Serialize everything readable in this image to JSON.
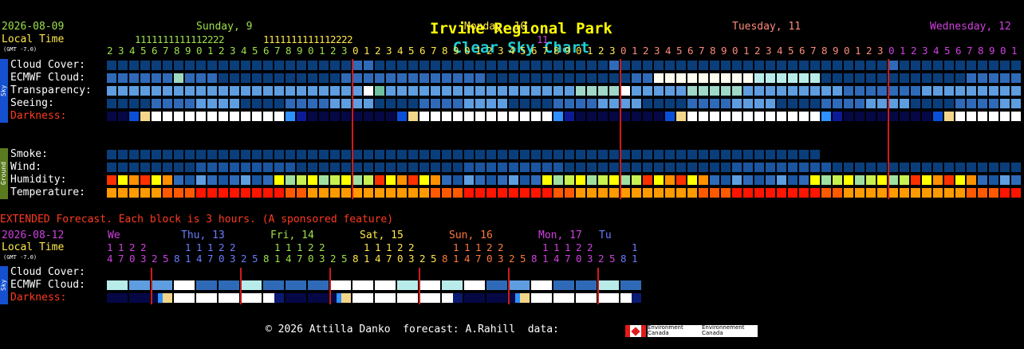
{
  "title": {
    "location": "Irvine Regional Park",
    "suffix": "Clear Sky Chart",
    "location_color": "#ffff00",
    "suffix_color": "#1fcfd3"
  },
  "header": {
    "date": "2026-08-09",
    "local_time": "Local Time",
    "gmt": "(GMT -7.0)",
    "days": [
      {
        "label": "Sunday, 9",
        "color": "#9fe04a"
      },
      {
        "label": "Monday, 10",
        "color": "#ffe84a"
      },
      {
        "label": "Tuesday, 11",
        "color": "#ff8a7a"
      },
      {
        "label": "Wednesday, 12",
        "color": "#d040e0"
      }
    ],
    "tens_rows": [
      "          1 1 1 1 1 1 1 1 1 1 1 1 2 2 2 2",
      "                                                        1 1 1 1 1 1 1 1 1 1 1 1 2 2 2 2",
      "                                                                                                           1 1 1 1 1 1 1 1 1 1 1 1 2 2 2 2",
      "                                                                                                                                                          1 1"
    ],
    "ones_row": "2 3 4 5 6 7 8 9 0 1 2 3 4 5 6 7 8 9 0 1 2 3 0 1 2 3 4 5 6 7 8 9 0 1 2 3 4 5 6 7 8 9 0 1 2 3 0 1 2 3 4 5 6 7 8 9 0 1 2 3 4 5 6 7 8 9 0 1 2 3 0 1 2 3 4 5 6 7 8 9 0 1"
  },
  "sky_group_label": "Sky",
  "ground_group_label": "Ground",
  "rows": {
    "cloud_cover": "Cloud Cover:",
    "ecmwf_cloud": "ECMWF Cloud:",
    "transparency": "Transparency:",
    "seeing": "Seeing:",
    "darkness": "Darkness:",
    "smoke": "Smoke:",
    "wind": "Wind:",
    "humidity": "Humidity:",
    "temperature": "Temperature:"
  },
  "extended": {
    "notice": "EXTENDED Forecast. Each block is 3 hours. (A sponsored feature)",
    "date": "2026-08-12",
    "local_time": "Local Time",
    "gmt": "(GMT -7.0)",
    "days": [
      {
        "label": "We",
        "color": "#d040e0"
      },
      {
        "label": "Thu, 13",
        "color": "#6a7cff"
      },
      {
        "label": "Fri, 14",
        "color": "#9fe04a"
      },
      {
        "label": "Sat, 15",
        "color": "#ffe84a"
      },
      {
        "label": "Sun, 16",
        "color": "#ff7a3a"
      },
      {
        "label": "Mon, 17",
        "color": "#d040e0"
      },
      {
        "label": "Tu",
        "color": "#6a7cff"
      }
    ],
    "tens_row": "1 1 2 2       1 1 1 2 2       1 1 1 2 2       1 1 1 2 2       1 1 1 2 2       1 1 1 2 2       1",
    "ones_row": "4 7 0 3 2 5 8 1 4 7 0 3 2 5 8 1 4 7 0 3 2 5 8 1 4 7 0 3 2 5 8 1 4 7 0 3 2 5 8 1 4 7 0 3 2 5 8 1",
    "rows": {
      "cloud_cover": "Cloud Cover:",
      "ecmwf_cloud": "ECMWF Cloud:",
      "darkness": "Darkness:"
    }
  },
  "footer": {
    "copyright": "© 2026 Attilla Danko  forecast: A.Rahill  data:",
    "agency_en": "Environment\nCanada",
    "agency_fr": "Environnement\nCanada"
  },
  "colors": {
    "dark_blue": "#0a3e7a",
    "mid_blue": "#2f6ab8",
    "light_blue": "#5e9ee0",
    "sky_light": "#99c9ee",
    "white": "#ffffff",
    "darkness_colors": [
      "#050845",
      "#0c1a98",
      "#0a4fd8",
      "#2f90ff",
      "#f4d68a",
      "#ffffff"
    ],
    "midnight_line": "#d01a1a",
    "label_red": "#ff3a20"
  }
}
